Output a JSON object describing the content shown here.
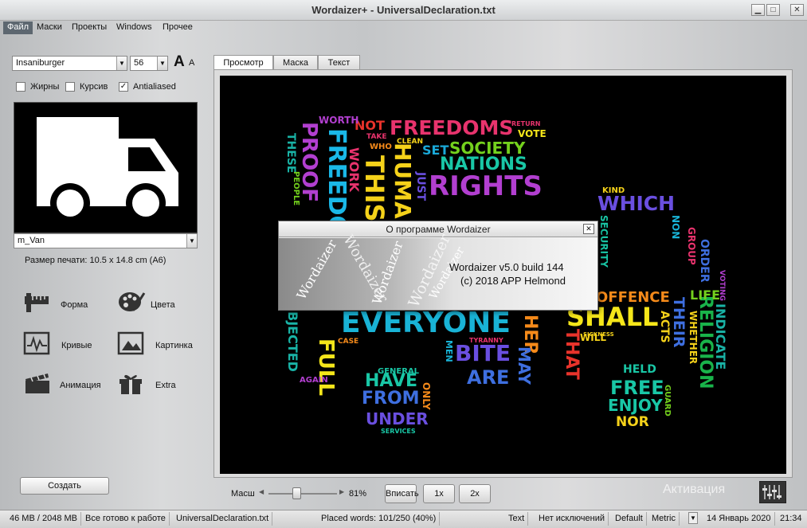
{
  "window": {
    "title": "Wordaizer+  - UniversalDeclaration.txt",
    "min": "▁",
    "max": "□",
    "close": "✕"
  },
  "menu": [
    "Файл",
    "Маски",
    "Проекты",
    "Windows",
    "Прочее"
  ],
  "font": {
    "name": "Insaniburger",
    "size": "56",
    "big_a": "A",
    "small_a": "A"
  },
  "style_checks": [
    {
      "label": "Жирны",
      "checked": false
    },
    {
      "label": "Курсив",
      "checked": false
    },
    {
      "label": "Antialiased",
      "checked": true
    }
  ],
  "mask": {
    "name": "m_Van",
    "print_size": "Размер печати: 10.5 x 14.8 cm (A6)"
  },
  "tools": [
    {
      "label": "Форма",
      "icon": "ruler-icon"
    },
    {
      "label": "Цвета",
      "icon": "palette-icon"
    },
    {
      "label": "Кривые",
      "icon": "curve-icon"
    },
    {
      "label": "Картинка",
      "icon": "picture-icon"
    },
    {
      "label": "Анимация",
      "icon": "clapper-icon"
    },
    {
      "label": "Extra",
      "icon": "gift-icon"
    }
  ],
  "create_button": "Создать",
  "tabs": [
    "Просмотр",
    "Маска",
    "Текст"
  ],
  "words": [
    {
      "t": "FREEDOMS",
      "c": "#e8336d"
    },
    {
      "t": "NOT",
      "c": "#e8332b"
    },
    {
      "t": "SOCIETY",
      "c": "#74d11d"
    },
    {
      "t": "SET",
      "c": "#1aa9d9"
    },
    {
      "t": "NATIONS",
      "c": "#19c7a6"
    },
    {
      "t": "RIGHTS",
      "c": "#b23fd0"
    },
    {
      "t": "HUMAN",
      "c": "#f5d21a"
    },
    {
      "t": "THIS",
      "c": "#f5d21a"
    },
    {
      "t": "FREEDO",
      "c": "#1ab8e8"
    },
    {
      "t": "PROOF",
      "c": "#b23fd0"
    },
    {
      "t": "WORK",
      "c": "#e8336d"
    },
    {
      "t": "WHICH",
      "c": "#6a4fe0"
    },
    {
      "t": "EVERYONE",
      "c": "#19b3d6"
    },
    {
      "t": "SHALL",
      "c": "#f5e61a"
    },
    {
      "t": "OFFENCE",
      "c": "#f58a1a"
    },
    {
      "t": "BITE",
      "c": "#6a4fe0"
    },
    {
      "t": "ARE",
      "c": "#3e6fe0"
    },
    {
      "t": "HAVE",
      "c": "#19c7a6"
    },
    {
      "t": "FROM",
      "c": "#3e6fe0"
    },
    {
      "t": "UNDER",
      "c": "#6a4fe0"
    },
    {
      "t": "FREE",
      "c": "#19c7a6"
    },
    {
      "t": "ENJOY",
      "c": "#19c7a6"
    },
    {
      "t": "HELD",
      "c": "#19c7a6"
    },
    {
      "t": "NOR",
      "c": "#f5d21a"
    },
    {
      "t": "THEIR",
      "c": "#3e6fe0"
    },
    {
      "t": "RELIGION",
      "c": "#19b34a"
    },
    {
      "t": "INDICATE",
      "c": "#19b3a6"
    },
    {
      "t": "LIFE",
      "c": "#74d11d"
    },
    {
      "t": "THAT",
      "c": "#e8332b"
    },
    {
      "t": "HER",
      "c": "#f58a1a"
    },
    {
      "t": "MAY",
      "c": "#3e6fe0"
    },
    {
      "t": "FULL",
      "c": "#f5e61a"
    },
    {
      "t": "ACTS",
      "c": "#f5d21a"
    },
    {
      "t": "WHETHER",
      "c": "#f5d21a"
    },
    {
      "t": "VOTE",
      "c": "#f5e61a"
    },
    {
      "t": "WORTH",
      "c": "#b23fd0"
    },
    {
      "t": "SERVICES",
      "c": "#19c7a6"
    },
    {
      "t": "GENERAL",
      "c": "#19c7a6"
    },
    {
      "t": "ONLY",
      "c": "#f58a1a"
    },
    {
      "t": "AGAIN",
      "c": "#b23fd0"
    },
    {
      "t": "KIND",
      "c": "#f5d21a"
    },
    {
      "t": "NON",
      "c": "#19b3d6"
    },
    {
      "t": "ORDER",
      "c": "#3e6fe0"
    },
    {
      "t": "GROUP",
      "c": "#e8336d"
    },
    {
      "t": "GUARD",
      "c": "#74d11d"
    },
    {
      "t": "SECURITY",
      "c": "#19c7a6"
    },
    {
      "t": "MEN",
      "c": "#19b3d6"
    },
    {
      "t": "WILL",
      "c": "#f5d21a"
    },
    {
      "t": "CLEAN",
      "c": "#f5d21a"
    },
    {
      "t": "TAKE",
      "c": "#e8336d"
    },
    {
      "t": "WHO",
      "c": "#f58a1a"
    },
    {
      "t": "JUST",
      "c": "#6a4fe0"
    },
    {
      "t": "RETURN",
      "c": "#e8336d"
    },
    {
      "t": "BJECTED",
      "c": "#19b3a6"
    },
    {
      "t": "THESE",
      "c": "#19b3a6"
    },
    {
      "t": "PEOPLE",
      "c": "#74d11d"
    },
    {
      "t": "VOTING",
      "c": "#b23fd0"
    },
    {
      "t": "SICKNESS",
      "c": "#f5d21a"
    },
    {
      "t": "TYRANNY",
      "c": "#e8336d"
    },
    {
      "t": "CASE",
      "c": "#f58a1a"
    }
  ],
  "dialog": {
    "title": "О программе Wordaizer",
    "line1": "Wordaizer v5.0 build 144",
    "line2": "(c) 2018 APP Helmond",
    "watermark": [
      "Wordaizer",
      "Wordaizer",
      "Wordaizer",
      "Wordaizer",
      "Wordaizer"
    ]
  },
  "zoom": {
    "label": "Масш",
    "value": "81%",
    "fraction": 0.42
  },
  "zoom_buttons": [
    "Вписать",
    "1x",
    "2x"
  ],
  "activation": "Активация",
  "status": [
    "46 MB / 2048 MB",
    "Все готово к работе",
    "UniversalDeclaration.txt",
    "Placed words: 101/250 (40%)",
    "Text",
    "Нет исключений",
    "Default",
    "Metric",
    "14 Январь 2020",
    "21:34"
  ]
}
